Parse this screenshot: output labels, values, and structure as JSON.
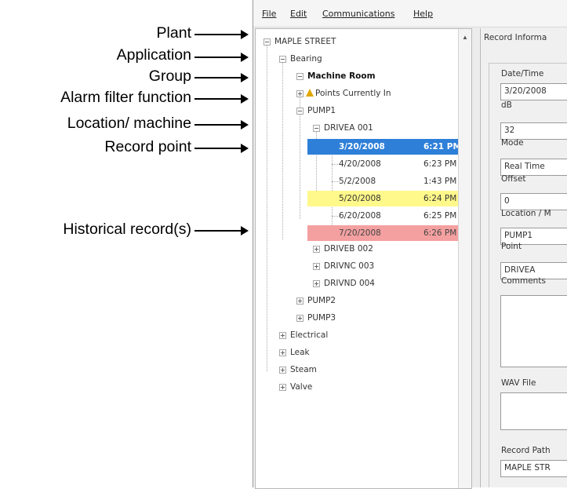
{
  "annotations": [
    {
      "label": "Plant"
    },
    {
      "label": "Application"
    },
    {
      "label": "Group"
    },
    {
      "label": "Alarm filter function"
    },
    {
      "label": "Location/ machine"
    },
    {
      "label": "Record point"
    },
    {
      "label": "Historical record(s)"
    }
  ],
  "menu": [
    "File",
    "Edit",
    "Communications",
    "Help"
  ],
  "tree": {
    "plant": "MAPLE STREET",
    "application": "Bearing",
    "group": "Machine Room",
    "alarm_filter": "Points Currently In",
    "pump1": "PUMP1",
    "drivea": "DRIVEA 001",
    "records": [
      {
        "date": "3/20/2008",
        "time": "6:21 PM",
        "highlight": "selected"
      },
      {
        "date": "4/20/2008",
        "time": "6:23 PM",
        "highlight": "none"
      },
      {
        "date": "5/2/2008",
        "time": "1:43 PM",
        "highlight": "none"
      },
      {
        "date": "5/20/2008",
        "time": "6:24 PM",
        "highlight": "yellow"
      },
      {
        "date": "6/20/2008",
        "time": "6:25 PM",
        "highlight": "none"
      },
      {
        "date": "7/20/2008",
        "time": "6:26 PM",
        "highlight": "red"
      }
    ],
    "driveb": "DRIVEB 002",
    "drivec": "DRIVNC 003",
    "drived": "DRIVND 004",
    "pump2": "PUMP2",
    "pump3": "PUMP3",
    "apps": [
      "Electrical",
      "Leak",
      "Steam",
      "Valve"
    ]
  },
  "record_info": {
    "title": "Record Informa",
    "fields": [
      {
        "label": "Date/Time",
        "value": "3/20/2008"
      },
      {
        "label": "dB",
        "value": "32"
      },
      {
        "label": "Mode",
        "value": "Real Time"
      },
      {
        "label": "Offset",
        "value": "0"
      },
      {
        "label": "Location / M",
        "value": "PUMP1"
      },
      {
        "label": "Point",
        "value": "DRIVEA"
      },
      {
        "label": "Comments",
        "value": ""
      },
      {
        "label": "WAV File",
        "value": ""
      },
      {
        "label": "Record Path",
        "value": "MAPLE STR"
      }
    ]
  },
  "colors": {
    "selected": "#2e7fd8",
    "yellow": "#fff88a",
    "red": "#f4a0a0"
  }
}
